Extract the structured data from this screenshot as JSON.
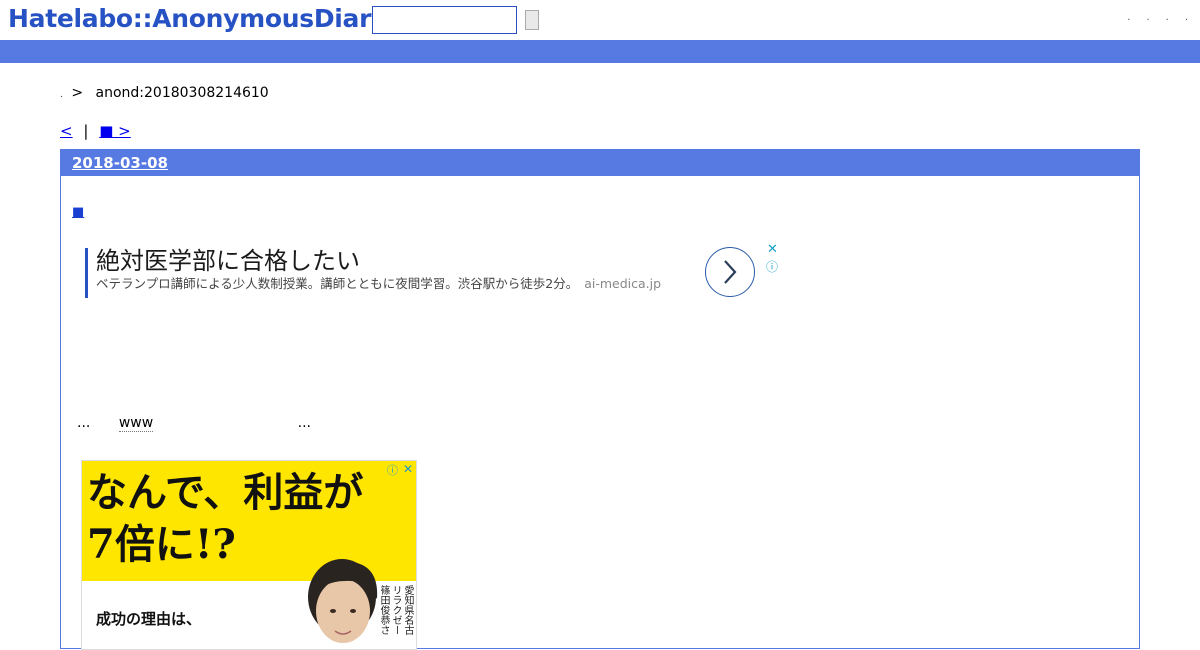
{
  "header": {
    "logo_text": "Hatelabo::AnonymousDiary",
    "search_value": "",
    "header_links": [
      ".",
      ".",
      ".",
      "."
    ]
  },
  "breadcrumb": {
    "dot": ".",
    "separator": ">",
    "current": "anond:20180308214610"
  },
  "pager": {
    "prev": "<",
    "divider": "|",
    "mark": "■",
    "next": ">"
  },
  "day": {
    "date": "2018-03-08",
    "entry_mark": "■",
    "text_before": "...",
    "text_www": "www",
    "text_after": "..."
  },
  "text_ad": {
    "title": "絶対医学部に合格したい",
    "description": "ベテランプロ講師による少人数制授業。講師とともに夜間学習。渋谷駅から徒歩2分。",
    "domain": "ai-medica.jp",
    "close_glyph": "✕",
    "info_glyph": "ⓘ"
  },
  "banner_ad": {
    "headline": "なんで、利益が\n7倍に!?",
    "subtext": "成功の理由は、",
    "vertical_text": [
      "愛知県名古",
      "リラクゼー",
      "篠田俊恭さ"
    ],
    "close_glyph": "✕",
    "info_glyph": "ⓘ",
    "accent_color": "#ffe600"
  },
  "colors": {
    "brand_blue": "#2752c4",
    "bar_blue": "#5779e2"
  }
}
